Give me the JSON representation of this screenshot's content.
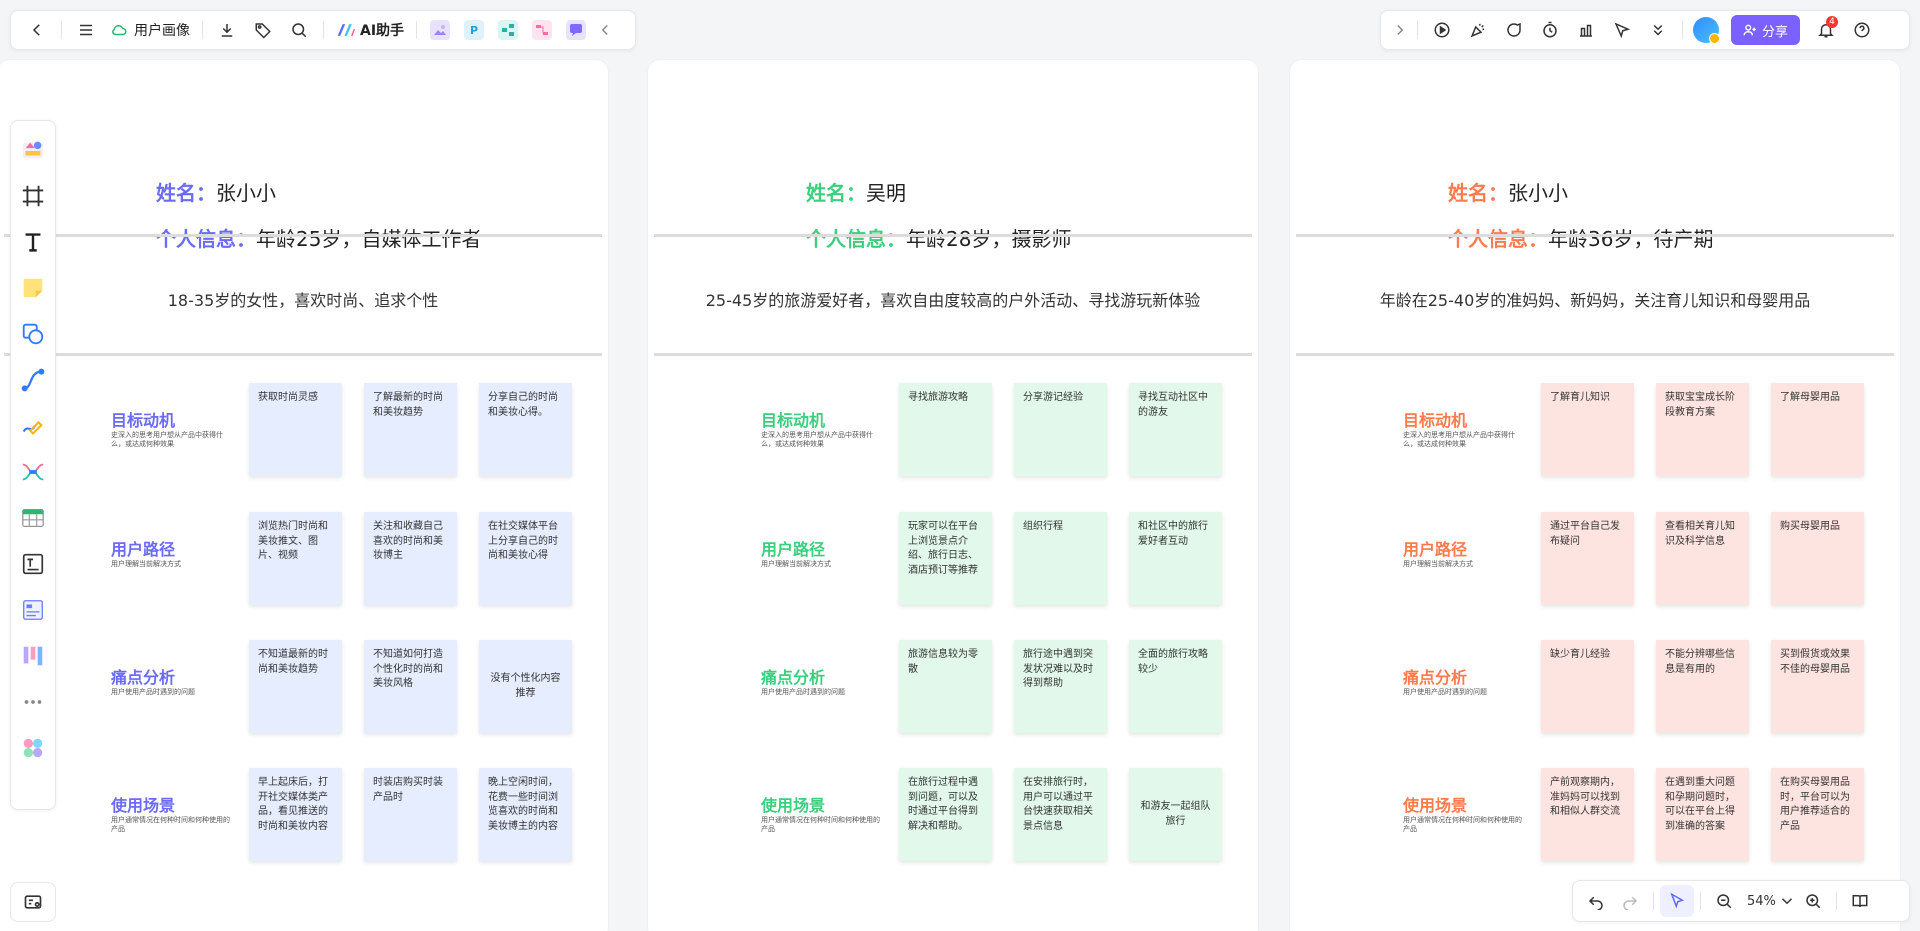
{
  "toolbar": {
    "doc_title": "用户画像",
    "ai_label": "AI助手",
    "share_label": "分享",
    "notification_count": "4",
    "app_icons": [
      {
        "name": "image-app-icon",
        "color": "#b8a6ff"
      },
      {
        "name": "p-app-icon",
        "color": "#3cb4e5",
        "letter": "P"
      },
      {
        "name": "flow-app-icon",
        "color": "#2bc1b0"
      },
      {
        "name": "mindmap-app-icon",
        "color": "#ff7aa8"
      },
      {
        "name": "chat-app-icon",
        "color": "#8b7bff"
      }
    ]
  },
  "zoom": {
    "value": "54%"
  },
  "boards": [
    {
      "accent": "#6b6bf5",
      "sticky_color": "#e6edff",
      "name_label": "姓名：",
      "name_value": "张小小",
      "info_label": "个人信息：",
      "info_value": "年龄25岁，自媒体工作者",
      "description": "18-35岁的女性，喜欢时尚、追求个性",
      "rows": [
        {
          "title": "目标动机",
          "subtitle": "史深入的思考用户想从产品中获得什么，或达成何种效果",
          "notes": [
            {
              "text": "获取时尚灵感"
            },
            {
              "text": "了解最新的时尚和美妆趋势"
            },
            {
              "text": "分享自己的时尚和美妆心得。"
            }
          ]
        },
        {
          "title": "用户路径",
          "subtitle": "用户理解当前解决方式",
          "notes": [
            {
              "text": "浏览热门时尚和美妆推文、图片、视频"
            },
            {
              "text": "关注和收藏自己喜欢的时尚和美妆博主"
            },
            {
              "text": "在社交媒体平台上分享自己的时尚和美妆心得"
            }
          ]
        },
        {
          "title": "痛点分析",
          "subtitle": "用户使用产品时遇到的问题",
          "notes": [
            {
              "text": "不知道最新的时尚和美妆趋势"
            },
            {
              "text": "不知道如何打造个性化时的尚和美妆风格"
            },
            {
              "text": "没有个性化内容推荐",
              "center": true
            }
          ]
        },
        {
          "title": "使用场景",
          "subtitle": "用户通常情况在何种时间和何种使用的产品",
          "notes": [
            {
              "text": "早上起床后，打开社交媒体类产品，看见推送的时尚和美妆内容"
            },
            {
              "text": "时装店购买时装产品时"
            },
            {
              "text": "晚上空闲时间，花费一些时间浏览喜欢的时尚和美妆博主的内容"
            }
          ]
        }
      ]
    },
    {
      "accent": "#3ccf7e",
      "sticky_color": "#e1f8ea",
      "name_label": "姓名：",
      "name_value": "吴明",
      "info_label": "个人信息：",
      "info_value": "年龄28岁，摄影师",
      "description": "25-45岁的旅游爱好者，喜欢自由度较高的户外活动、寻找游玩新体验",
      "rows": [
        {
          "title": "目标动机",
          "subtitle": "史深入的思考用户想从产品中获得什么，或达成何种效果",
          "notes": [
            {
              "text": "寻找旅游攻略"
            },
            {
              "text": "分享游记经验"
            },
            {
              "text": "寻找互动社区中的游友"
            }
          ]
        },
        {
          "title": "用户路径",
          "subtitle": "用户理解当前解决方式",
          "notes": [
            {
              "text": "玩家可以在平台上浏览景点介绍、旅行日志、酒店预订等推荐"
            },
            {
              "text": "组织行程"
            },
            {
              "text": "和社区中的旅行爱好者互动"
            }
          ]
        },
        {
          "title": "痛点分析",
          "subtitle": "用户使用产品时遇到的问题",
          "notes": [
            {
              "text": "旅游信息较为零散"
            },
            {
              "text": "旅行途中遇到突发状况难以及时得到帮助"
            },
            {
              "text": "全面的旅行攻略较少"
            }
          ]
        },
        {
          "title": "使用场景",
          "subtitle": "用户通常情况在何种时间和何种使用的产品",
          "notes": [
            {
              "text": "在旅行过程中遇到问题，可以及时通过平台得到解决和帮助。"
            },
            {
              "text": "在安排旅行时，用户可以通过平台快速获取相关景点信息"
            },
            {
              "text": "和游友一起组队旅行",
              "center": true
            }
          ]
        }
      ]
    },
    {
      "accent": "#ff7a4d",
      "sticky_color": "#fde4e0",
      "name_label": "姓名：",
      "name_value": "张小小",
      "info_label": "个人信息：",
      "info_value": "年龄36岁，待产期",
      "description": "年龄在25-40岁的准妈妈、新妈妈，关注育儿知识和母婴用品",
      "rows": [
        {
          "title": "目标动机",
          "subtitle": "史深入的思考用户想从产品中获得什么，或达成何种效果",
          "notes": [
            {
              "text": "了解育儿知识"
            },
            {
              "text": "获取宝宝成长阶段教育方案"
            },
            {
              "text": "了解母婴用品"
            }
          ]
        },
        {
          "title": "用户路径",
          "subtitle": "用户理解当前解决方式",
          "notes": [
            {
              "text": "通过平台自己发布疑问"
            },
            {
              "text": "查看相关育儿知识及科学信息"
            },
            {
              "text": "购买母婴用品"
            }
          ]
        },
        {
          "title": "痛点分析",
          "subtitle": "用户使用产品时遇到的问题",
          "notes": [
            {
              "text": "缺少育儿经验"
            },
            {
              "text": "不能分辨哪些信息是有用的"
            },
            {
              "text": "买到假货或效果不佳的母婴用品"
            }
          ]
        },
        {
          "title": "使用场景",
          "subtitle": "用户通常情况在何种时间和何种使用的产品",
          "notes": [
            {
              "text": "产前观察期内，准妈妈可以找到和相似人群交流"
            },
            {
              "text": "在遇到重大问题和孕期问题时，可以在平台上得到准确的答案"
            },
            {
              "text": "在购买母婴用品时，平台可以为用户推荐适合的产品"
            }
          ]
        }
      ]
    }
  ]
}
